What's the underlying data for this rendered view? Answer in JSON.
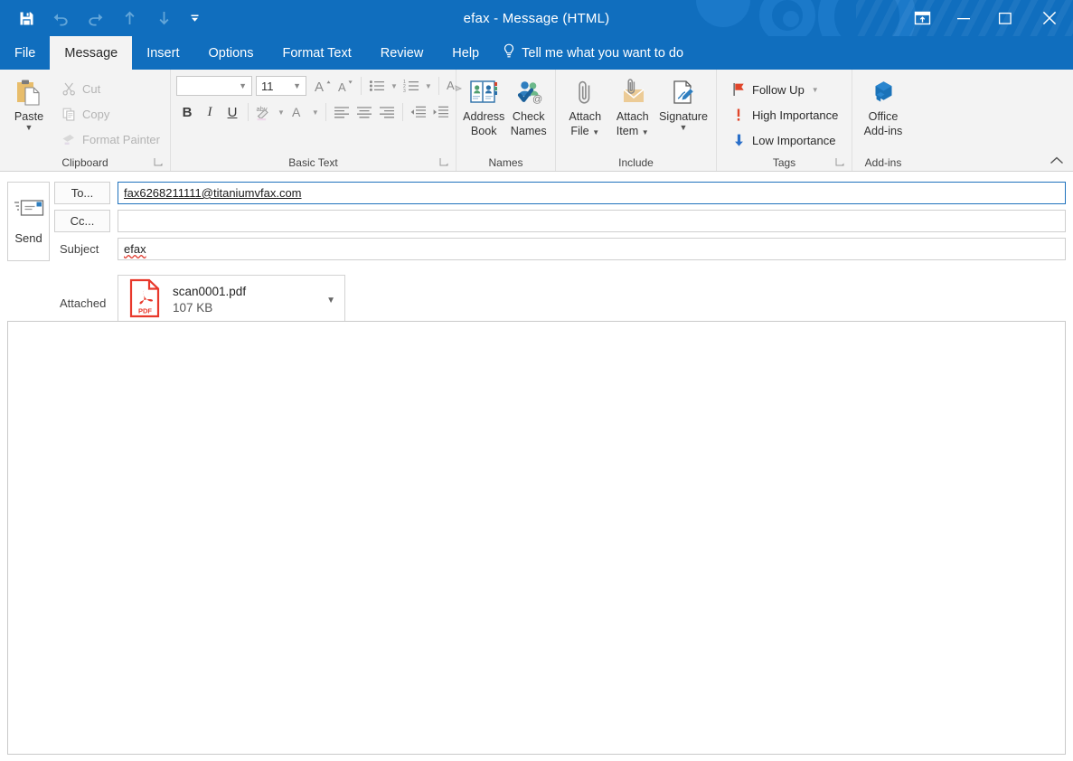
{
  "window": {
    "title": "efax  -  Message (HTML)",
    "accent_color": "#106ebe",
    "quick_access": [
      {
        "name": "save",
        "label": "Save",
        "icon": "save-icon",
        "state": "enabled"
      },
      {
        "name": "undo",
        "label": "Undo",
        "icon": "undo-icon",
        "state": "disabled"
      },
      {
        "name": "redo",
        "label": "Redo",
        "icon": "redo-icon",
        "state": "disabled"
      },
      {
        "name": "previous-item",
        "label": "Previous Item",
        "icon": "arrow-up-icon",
        "state": "enabled"
      },
      {
        "name": "next-item",
        "label": "Next Item",
        "icon": "arrow-down-icon",
        "state": "enabled"
      },
      {
        "name": "customize-quick-access-toolbar",
        "label": "Customize Quick Access Toolbar",
        "icon": "chevron-down-icon",
        "state": "enabled"
      }
    ],
    "controls": [
      {
        "name": "ribbon-display-options",
        "icon": "ribbon-display-options-icon"
      },
      {
        "name": "minimize",
        "icon": "minimize-icon"
      },
      {
        "name": "maximize",
        "icon": "maximize-icon"
      },
      {
        "name": "close",
        "icon": "close-icon"
      }
    ]
  },
  "tabs": [
    {
      "label": "File",
      "active": false
    },
    {
      "label": "Message",
      "active": true
    },
    {
      "label": "Insert",
      "active": false
    },
    {
      "label": "Options",
      "active": false
    },
    {
      "label": "Format Text",
      "active": false
    },
    {
      "label": "Review",
      "active": false
    },
    {
      "label": "Help",
      "active": false
    }
  ],
  "tell_me": {
    "label": "Tell me what you want to do",
    "icon": "lightbulb-icon"
  },
  "ribbon": {
    "collapse_label": "Collapse the Ribbon",
    "groups": {
      "clipboard": {
        "label": "Clipboard",
        "paste": {
          "label": "Paste",
          "icon": "clipboard-icon"
        },
        "cut": {
          "label": "Cut",
          "icon": "scissors-icon"
        },
        "copy": {
          "label": "Copy",
          "icon": "copy-icon"
        },
        "format_painter": {
          "label": "Format Painter",
          "icon": "paintbrush-icon"
        }
      },
      "basic_text": {
        "label": "Basic Text",
        "font_name": {
          "value": "",
          "placeholder": ""
        },
        "font_size": {
          "value": "11"
        },
        "grow_font": {
          "label": "A",
          "name": "increase-font-size"
        },
        "shrink_font": {
          "label": "A",
          "name": "decrease-font-size"
        },
        "bullets": {
          "label": "Bullets"
        },
        "numbering": {
          "label": "Numbering"
        },
        "clear_formatting": {
          "label": "Clear All Formatting"
        },
        "bold": {
          "label": "B"
        },
        "italic": {
          "label": "I"
        },
        "underline": {
          "label": "U"
        },
        "highlight": {
          "label": "Text Highlight Color"
        },
        "font_color": {
          "label": "A"
        },
        "align_left": {
          "label": "Align Left"
        },
        "align_center": {
          "label": "Center"
        },
        "align_right": {
          "label": "Align Right"
        },
        "decrease_indent": {
          "label": "Decrease Indent"
        },
        "increase_indent": {
          "label": "Increase Indent"
        }
      },
      "names": {
        "label": "Names",
        "address_book": {
          "line1": "Address",
          "line2": "Book",
          "icon": "address-book-icon"
        },
        "check_names": {
          "line1": "Check",
          "line2": "Names",
          "icon": "check-names-icon"
        }
      },
      "include": {
        "label": "Include",
        "attach_file": {
          "line1": "Attach",
          "line2": "File",
          "icon": "paperclip-icon",
          "has_caret": true
        },
        "attach_item": {
          "line1": "Attach",
          "line2": "Item",
          "icon": "envelope-attach-icon",
          "has_caret": true
        },
        "signature": {
          "line1": "Signature",
          "line2": "",
          "icon": "signature-icon",
          "has_caret": true
        }
      },
      "tags": {
        "label": "Tags",
        "follow_up": {
          "label": "Follow Up",
          "icon": "flag-icon",
          "color": "#e0452a",
          "has_caret": true
        },
        "high_importance": {
          "label": "High Importance",
          "icon": "exclamation-icon",
          "color": "#e0452a"
        },
        "low_importance": {
          "label": "Low Importance",
          "icon": "arrow-down-icon",
          "color": "#2a6fc9"
        }
      },
      "addins": {
        "label": "Add-ins",
        "office_addins": {
          "line1": "Office",
          "line2": "Add-ins",
          "icon": "office-addins-icon"
        }
      }
    }
  },
  "compose": {
    "send": {
      "label": "Send",
      "icon": "send-envelope-icon"
    },
    "to": {
      "button_label": "To...",
      "value": "fax6268211111@titaniumvfax.com"
    },
    "cc": {
      "button_label": "Cc...",
      "value": ""
    },
    "subject": {
      "label": "Subject",
      "value": "efax"
    },
    "attached": {
      "label": "Attached",
      "file_name": "scan0001.pdf",
      "file_size": "107 KB",
      "icon": "pdf-file-icon",
      "menu_icon": "chevron-down-icon"
    },
    "body": {
      "value": ""
    }
  }
}
